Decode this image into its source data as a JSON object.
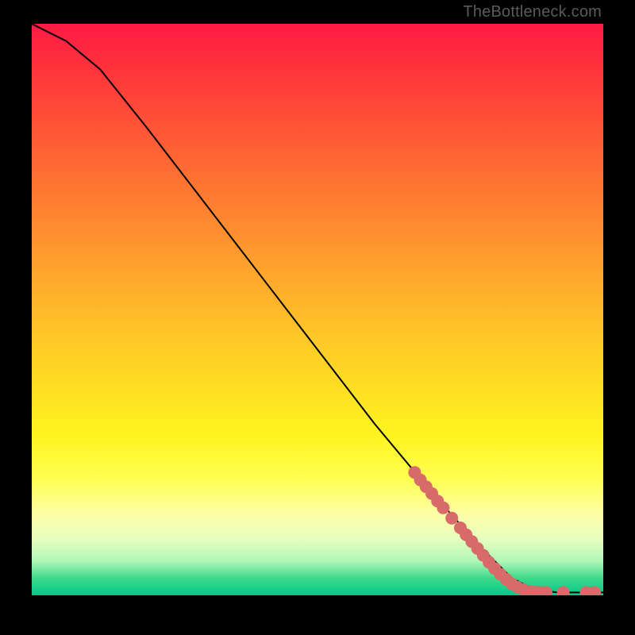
{
  "attribution": "TheBottleneck.com",
  "chart_data": {
    "type": "line",
    "title": "",
    "xlabel": "",
    "ylabel": "",
    "xlim": [
      0,
      100
    ],
    "ylim": [
      0,
      100
    ],
    "curve": [
      {
        "x": 0,
        "y": 100
      },
      {
        "x": 6,
        "y": 97
      },
      {
        "x": 12,
        "y": 92
      },
      {
        "x": 20,
        "y": 82
      },
      {
        "x": 30,
        "y": 69
      },
      {
        "x": 40,
        "y": 56
      },
      {
        "x": 50,
        "y": 43
      },
      {
        "x": 60,
        "y": 30
      },
      {
        "x": 70,
        "y": 18
      },
      {
        "x": 78,
        "y": 9
      },
      {
        "x": 84,
        "y": 3
      },
      {
        "x": 88,
        "y": 1
      },
      {
        "x": 92,
        "y": 0.5
      },
      {
        "x": 100,
        "y": 0.5
      }
    ],
    "series": [
      {
        "name": "points",
        "points": [
          {
            "x": 67,
            "y": 21.5
          },
          {
            "x": 68,
            "y": 20.2
          },
          {
            "x": 69,
            "y": 19.0
          },
          {
            "x": 70,
            "y": 17.8
          },
          {
            "x": 71,
            "y": 16.5
          },
          {
            "x": 72,
            "y": 15.3
          },
          {
            "x": 73.5,
            "y": 13.5
          },
          {
            "x": 75,
            "y": 11.8
          },
          {
            "x": 76,
            "y": 10.6
          },
          {
            "x": 77,
            "y": 9.4
          },
          {
            "x": 78,
            "y": 8.2
          },
          {
            "x": 79,
            "y": 7.0
          },
          {
            "x": 80,
            "y": 5.8
          },
          {
            "x": 81,
            "y": 4.7
          },
          {
            "x": 82,
            "y": 3.7
          },
          {
            "x": 83,
            "y": 2.8
          },
          {
            "x": 84,
            "y": 2.0
          },
          {
            "x": 85,
            "y": 1.4
          },
          {
            "x": 86,
            "y": 1.0
          },
          {
            "x": 87,
            "y": 0.7
          },
          {
            "x": 88,
            "y": 0.6
          },
          {
            "x": 89,
            "y": 0.5
          },
          {
            "x": 90,
            "y": 0.5
          },
          {
            "x": 93,
            "y": 0.5
          },
          {
            "x": 97,
            "y": 0.5
          },
          {
            "x": 98.5,
            "y": 0.5
          }
        ]
      }
    ],
    "colors": {
      "curve": "#000000",
      "point_fill": "#d86a6a",
      "point_stroke": "#b24a4a"
    }
  }
}
